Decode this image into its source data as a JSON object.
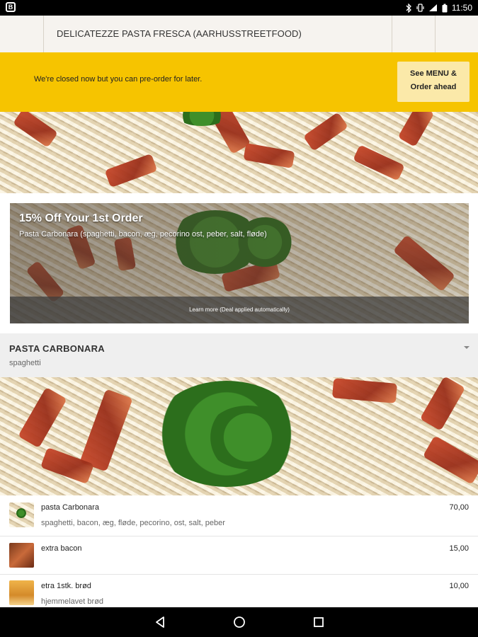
{
  "status_bar": {
    "time": "11:50",
    "icons": [
      "bluetooth-icon",
      "vibrate-icon",
      "signal-icon",
      "battery-icon"
    ]
  },
  "header": {
    "title": "DELICATEZZE PASTA FRESCA (AARHUSSTREETFOOD)"
  },
  "closed_banner": {
    "message": "We're closed now but you can pre-order for later.",
    "button_line1": "See MENU &",
    "button_line2": "Order ahead",
    "background": "#f6c400"
  },
  "deal": {
    "title": "15% Off Your 1st Order",
    "description": "Pasta Carbonara (spaghetti, bacon, æg, pecorino ost, peber, salt, fløde)",
    "learn_more": "Learn more (Deal applied automatically)"
  },
  "category": {
    "title": "PASTA CARBONARA",
    "subtitle": "spaghetti"
  },
  "items": [
    {
      "name": "pasta Carbonara",
      "description": "spaghetti, bacon, æg, fløde, pecorino, ost, salt, peber",
      "price": "70,00"
    },
    {
      "name": "extra bacon",
      "description": "",
      "price": "15,00"
    },
    {
      "name": "etra 1stk. brød",
      "description": "hjemmelavet brød",
      "price": "10,00"
    }
  ],
  "nav": {
    "buttons": [
      "back-icon",
      "home-icon",
      "recents-icon"
    ]
  }
}
